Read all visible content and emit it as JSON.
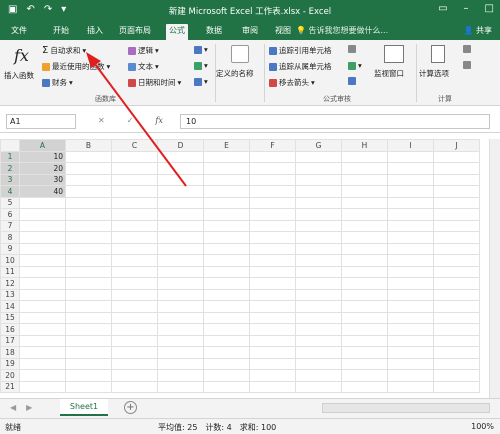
{
  "titlebar": {
    "title": "新建 Microsoft Excel 工作表.xlsx - Excel",
    "qat": [
      "save-icon",
      "undo-icon",
      "redo-icon",
      "customize-icon"
    ]
  },
  "tabs": [
    "文件",
    "开始",
    "插入",
    "页面布局",
    "公式",
    "数据",
    "审阅",
    "视图"
  ],
  "active_tab": "公式",
  "tellme": "告诉我您想要做什么...",
  "share": "共享",
  "ribbon": {
    "insert_function": "插入函数",
    "autosum": "自动求和",
    "recent": "最近使用的函数",
    "financial": "财务",
    "logical": "逻辑",
    "text": "文本",
    "datetime": "日期和时间",
    "define_name": "定义的名称",
    "trace_precedents": "追踪引用单元格",
    "trace_dependents": "追踪从属单元格",
    "remove_arrows": "移去箭头",
    "watch_window": "监视窗口",
    "calc_options": "计算选项",
    "group_function_lib": "函数库",
    "group_formula_audit": "公式审核",
    "group_calc": "计算"
  },
  "formula_bar": {
    "name_box": "A1",
    "fx_label": "fx",
    "value": "10"
  },
  "grid": {
    "columns": [
      "A",
      "B",
      "C",
      "D",
      "E",
      "F",
      "G",
      "H",
      "I",
      "J"
    ],
    "rows": [
      "1",
      "2",
      "3",
      "4",
      "5",
      "6",
      "7",
      "8",
      "9",
      "10",
      "11",
      "12",
      "13",
      "14",
      "15",
      "16",
      "17",
      "18",
      "19",
      "20",
      "21"
    ],
    "a_values": [
      "10",
      "20",
      "30",
      "40"
    ]
  },
  "sheet": {
    "tab": "Sheet1",
    "add": "+"
  },
  "status": {
    "ready": "就绪",
    "average": "平均值: 25",
    "count": "计数: 4",
    "sum": "求和: 100",
    "zoom": "100%"
  },
  "colors": {
    "brand": "#217346",
    "annotation_arrow": "#e02020"
  }
}
